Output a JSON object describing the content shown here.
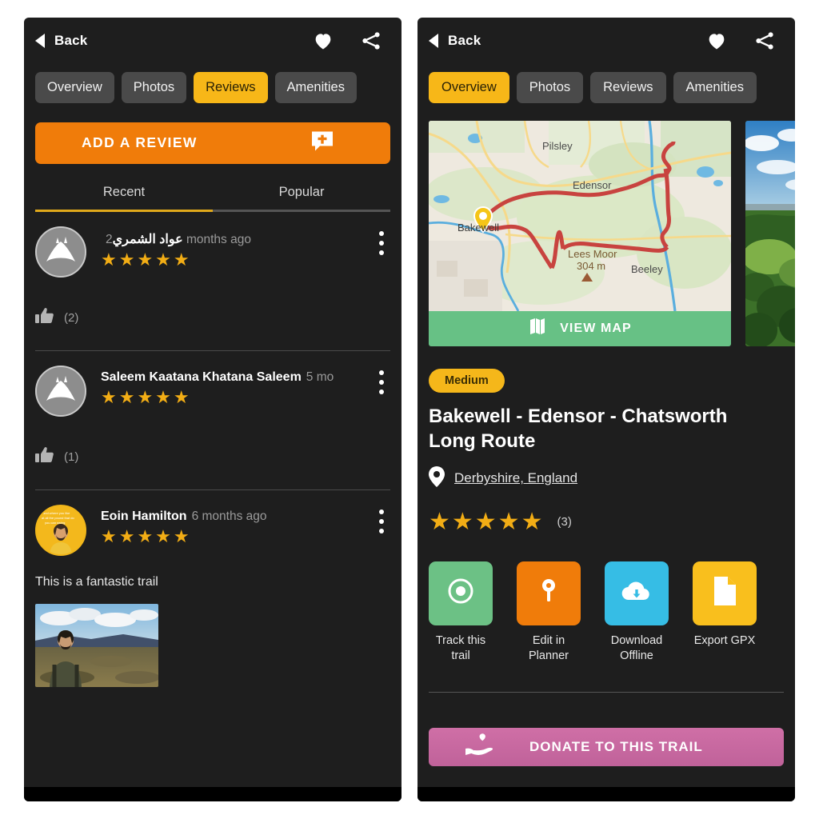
{
  "app": {
    "back_label": "Back",
    "icons": {
      "back": "back-arrow-icon",
      "favorite": "heart-icon",
      "share": "share-icon"
    }
  },
  "left_panel": {
    "tabs": [
      {
        "label": "Overview",
        "active": false
      },
      {
        "label": "Photos",
        "active": false
      },
      {
        "label": "Reviews",
        "active": true
      },
      {
        "label": "Amenities",
        "active": false
      }
    ],
    "add_review_button": {
      "label": "ADD A REVIEW",
      "icon": "add-comment-icon",
      "color": "#f07c0a"
    },
    "sort_tabs": [
      {
        "label": "Recent",
        "active": true
      },
      {
        "label": "Popular",
        "active": false
      }
    ],
    "reviews": [
      {
        "author": "عواد الشمري",
        "time": "2 months ago",
        "stars": "★★★★★",
        "text": "",
        "likes": "(2)",
        "avatar_type": "default-mountain-avatar",
        "has_photo": false
      },
      {
        "author": "Saleem Kaatana Khatana Saleem",
        "time": "5 mo",
        "stars": "★★★★★",
        "text": "",
        "likes": "(1)",
        "avatar_type": "default-mountain-avatar",
        "has_photo": false
      },
      {
        "author": "Eoin Hamilton",
        "time": "6 months ago",
        "stars": "★★★★★",
        "text": "This is a fantastic trail",
        "likes": "",
        "avatar_type": "user-photo-avatar",
        "has_photo": true
      }
    ]
  },
  "right_panel": {
    "tabs": [
      {
        "label": "Overview",
        "active": true
      },
      {
        "label": "Photos",
        "active": false
      },
      {
        "label": "Reviews",
        "active": false
      },
      {
        "label": "Amenities",
        "active": false
      }
    ],
    "map": {
      "labels": {
        "pilsley": "Pilsley",
        "edensor": "Edensor",
        "bakewell": "Bakewell",
        "lees_moor": "Lees Moor",
        "lees_moor_elev": "304 m",
        "beeley": "Beeley"
      },
      "view_map_button": {
        "label": "VIEW MAP",
        "icon": "map-icon",
        "color": "#67c185"
      },
      "route_color": "#c8433f"
    },
    "difficulty": {
      "label": "Medium",
      "color": "#f5b71a"
    },
    "title": "Bakewell - Edensor - Chatsworth Long Route",
    "location": {
      "label": "Derbyshire, England",
      "icon": "location-pin-icon"
    },
    "rating": {
      "stars": "★★★★★",
      "count": "(3)"
    },
    "actions": [
      {
        "label": "Track this trail",
        "icon": "record-target-icon",
        "color": "#6cc185"
      },
      {
        "label": "Edit in Planner",
        "icon": "map-pin-icon",
        "color": "#f07c0a"
      },
      {
        "label": "Download Offline",
        "icon": "cloud-download-icon",
        "color": "#36bde5"
      },
      {
        "label": "Export GPX",
        "icon": "file-icon",
        "color": "#f9bf1d"
      }
    ],
    "donate_button": {
      "label": "DONATE TO THIS TRAIL",
      "icon": "hand-heart-icon",
      "color": "#c0629a"
    }
  }
}
